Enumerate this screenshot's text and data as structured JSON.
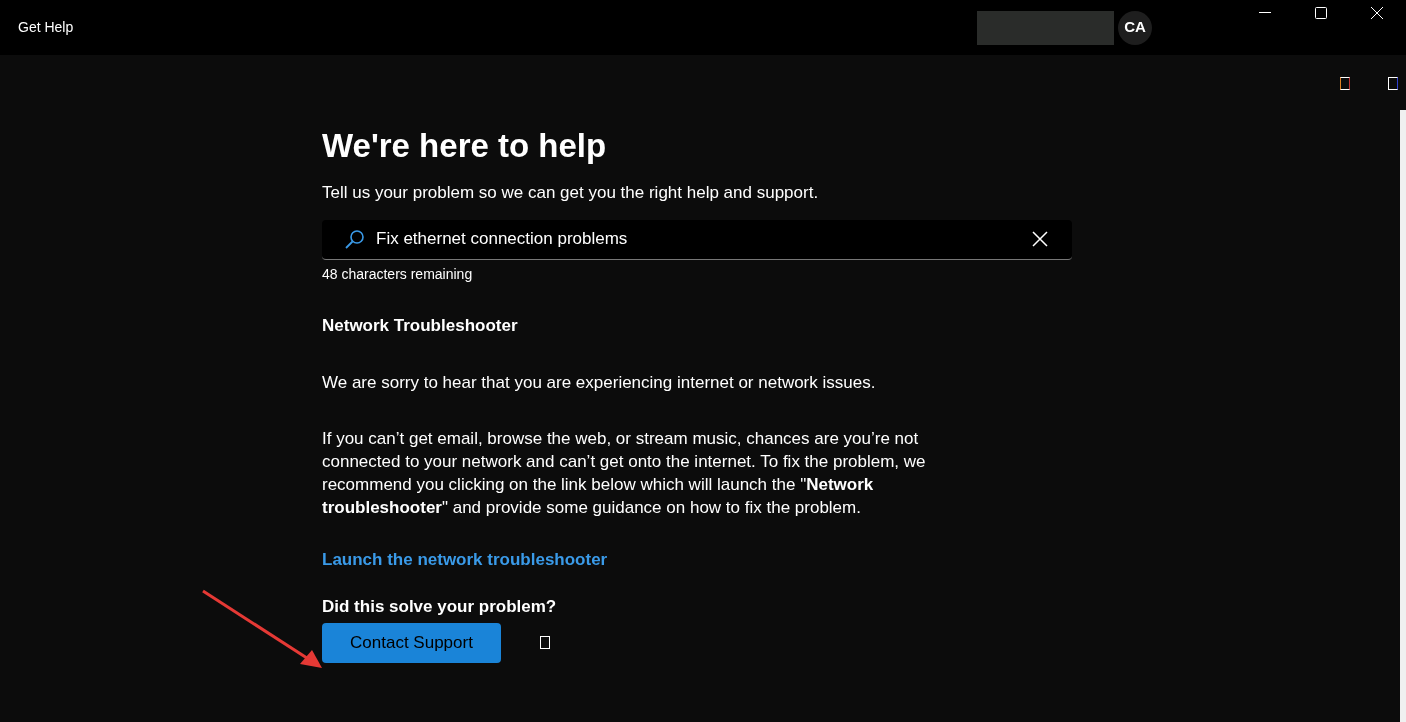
{
  "window": {
    "title": "Get Help",
    "account_initials": "CA"
  },
  "heading": "We're here to help",
  "subheading": "Tell us your problem so we can get you the right help and support.",
  "search": {
    "value": "Fix ethernet connection problems",
    "counter": "48 characters remaining"
  },
  "article": {
    "title": "Network Troubleshooter",
    "paragraphs": [
      "We are sorry to hear that you are experiencing internet or network issues.",
      "If you can’t get email, browse the web, or stream music, chances are you’re not connected to your network and can’t get onto the internet. To fix the problem, we recommend you clicking on the link below which will launch the \"**Network troubleshooter**\" and provide some guidance on how to fix the problem."
    ],
    "link": "Launch the network troubleshooter",
    "question": "Did this solve your problem?"
  },
  "contact_button": "Contact Support"
}
